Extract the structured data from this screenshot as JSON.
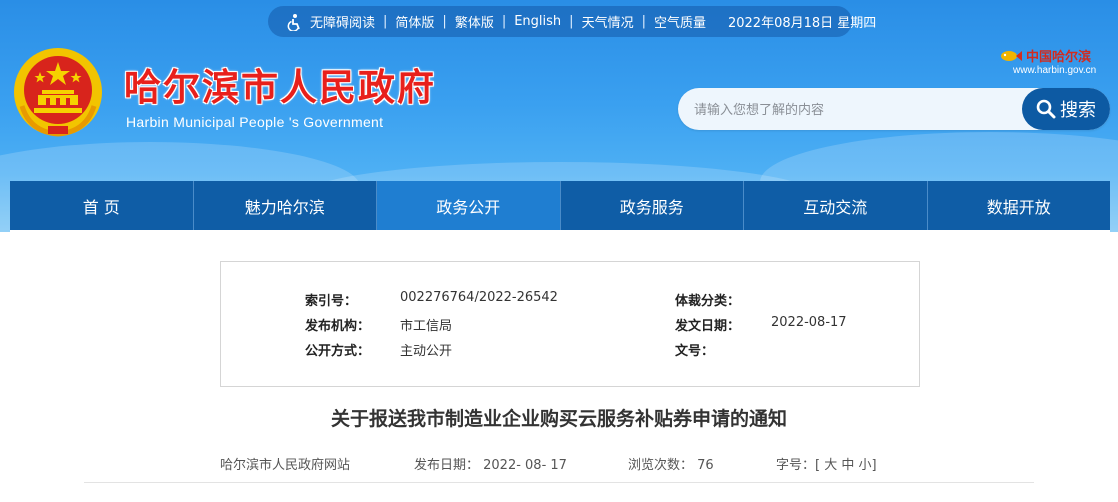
{
  "topbar": {
    "items": [
      "无障碍阅读",
      "简体版",
      "繁体版",
      "English",
      "天气情况",
      "空气质量"
    ],
    "date": "2022年08月18日 星期四"
  },
  "site": {
    "title": "哈尔滨市人民政府",
    "subtitle": "Harbin Municipal People 's Government",
    "brand_logo": "中国哈尔滨",
    "brand_url": "www.harbin.gov.cn"
  },
  "search": {
    "placeholder": "请输入您想了解的内容",
    "button": "搜索"
  },
  "nav": {
    "items": [
      "首 页",
      "魅力哈尔滨",
      "政务公开",
      "政务服务",
      "互动交流",
      "数据开放"
    ],
    "active": "政务公开"
  },
  "meta": {
    "index_label": "索引号：",
    "index_value": "002276764/2022-26542",
    "category_label": "体裁分类：",
    "category_value": "",
    "issuer_label": "发布机构：",
    "issuer_value": "市工信局",
    "date_label": "发文日期：",
    "date_value": "2022-08-17",
    "method_label": "公开方式：",
    "method_value": "主动公开",
    "docno_label": "文号：",
    "docno_value": ""
  },
  "article": {
    "title": "关于报送我市制造业企业购买云服务补贴券申请的通知",
    "source": "哈尔滨市人民政府网站",
    "publish_date": "发布日期： 2022- 08- 17",
    "views": "浏览次数： 76",
    "font_size": "字号：[ 大 中 小]"
  },
  "colors": {
    "header_blue": "#2a8ee6",
    "nav_blue": "#0f5da6",
    "nav_active": "#1f7ed1",
    "title_red": "#e8201b"
  }
}
